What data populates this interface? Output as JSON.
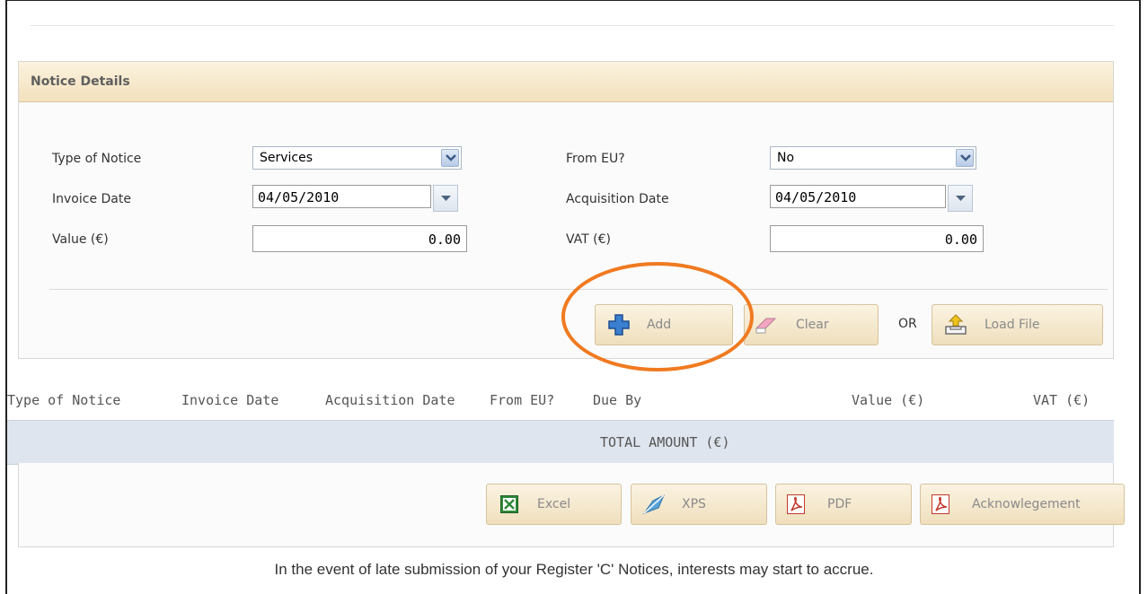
{
  "panel": {
    "title": "Notice Details"
  },
  "form": {
    "type_of_notice": {
      "label": "Type of Notice",
      "value": "Services"
    },
    "from_eu": {
      "label": "From EU?",
      "value": "No"
    },
    "invoice_date": {
      "label": "Invoice Date",
      "value": "04/05/2010"
    },
    "acquisition_date": {
      "label": "Acquisition Date",
      "value": "04/05/2010"
    },
    "value": {
      "label": "Value (€)",
      "value": "0.00"
    },
    "vat": {
      "label": "VAT (€)",
      "value": "0.00"
    }
  },
  "actions": {
    "add": "Add",
    "clear": "Clear",
    "or": "OR",
    "load_file": "Load File"
  },
  "table": {
    "columns": [
      "Type of Notice",
      "Invoice Date",
      "Acquisition Date",
      "From EU?",
      "Due By",
      "Value (€)",
      "VAT (€)"
    ],
    "total_label": "TOTAL AMOUNT (€)"
  },
  "export": {
    "excel": "Excel",
    "xps": "XPS",
    "pdf": "PDF",
    "acknowledgement": "Acknowlegement"
  },
  "footer": {
    "notice": "In the event of late submission of your Register 'C' Notices, interests may start to accrue."
  },
  "colors": {
    "highlight": "#f07a20",
    "header_bg": "#f2e1bd",
    "total_bg": "#dfe5ee"
  }
}
